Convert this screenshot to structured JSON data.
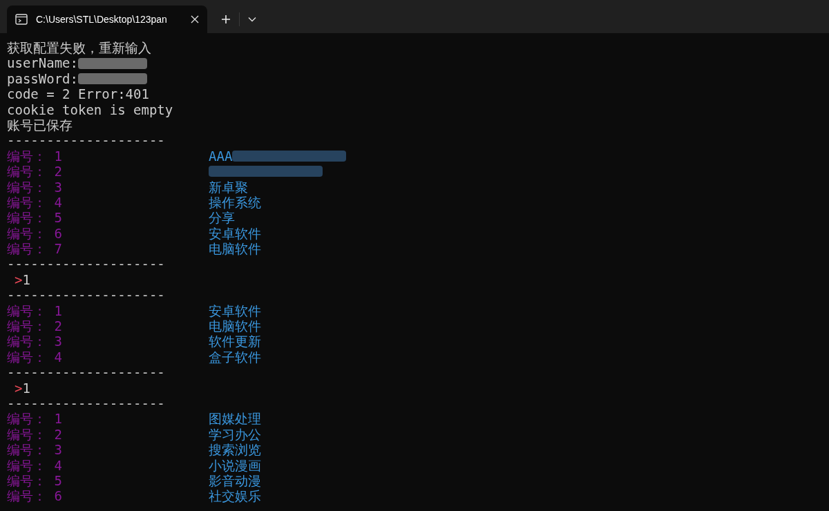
{
  "tab": {
    "title": "C:\\Users\\STL\\Desktop\\123pan"
  },
  "lines": [
    {
      "kind": "text",
      "text": "获取配置失败，重新输入"
    },
    {
      "kind": "field",
      "label": "userName:",
      "redacted": true
    },
    {
      "kind": "field",
      "label": "passWord:",
      "redacted": true
    },
    {
      "kind": "text",
      "text": "code = 2 Error:401"
    },
    {
      "kind": "text",
      "text": "cookie token is empty"
    },
    {
      "kind": "text",
      "text": "账号已保存"
    },
    {
      "kind": "separator",
      "text": "--------------------"
    },
    {
      "kind": "entry",
      "label": "编号： 1",
      "name": "AAA",
      "redacted": true
    },
    {
      "kind": "entry",
      "label": "编号： 2",
      "redacted": true
    },
    {
      "kind": "entry",
      "label": "编号： 3",
      "name": "新卓聚",
      "redacted": false
    },
    {
      "kind": "entry",
      "label": "编号： 4",
      "name": "操作系统",
      "redacted": false
    },
    {
      "kind": "entry",
      "label": "编号： 5",
      "name": "分享",
      "redacted": false
    },
    {
      "kind": "entry",
      "label": "编号： 6",
      "name": "安卓软件",
      "redacted": false
    },
    {
      "kind": "entry",
      "label": "编号： 7",
      "name": "电脑软件",
      "redacted": false
    },
    {
      "kind": "separator",
      "text": "--------------------"
    },
    {
      "kind": "prompt",
      "symbol": ">",
      "input": "1"
    },
    {
      "kind": "separator",
      "text": "--------------------"
    },
    {
      "kind": "entry",
      "label": "编号： 1",
      "name": "安卓软件",
      "redacted": false
    },
    {
      "kind": "entry",
      "label": "编号： 2",
      "name": "电脑软件",
      "redacted": false
    },
    {
      "kind": "entry",
      "label": "编号： 3",
      "name": "软件更新",
      "redacted": false
    },
    {
      "kind": "entry",
      "label": "编号： 4",
      "name": "盒子软件",
      "redacted": false
    },
    {
      "kind": "separator",
      "text": "--------------------"
    },
    {
      "kind": "prompt",
      "symbol": ">",
      "input": "1"
    },
    {
      "kind": "separator",
      "text": "--------------------"
    },
    {
      "kind": "entry",
      "label": "编号： 1",
      "name": "图媒处理",
      "redacted": false
    },
    {
      "kind": "entry",
      "label": "编号： 2",
      "name": "学习办公",
      "redacted": false
    },
    {
      "kind": "entry",
      "label": "编号： 3",
      "name": "搜索浏览",
      "redacted": false
    },
    {
      "kind": "entry",
      "label": "编号： 4",
      "name": "小说漫画",
      "redacted": false
    },
    {
      "kind": "entry",
      "label": "编号： 5",
      "name": "影音动漫",
      "redacted": false
    },
    {
      "kind": "entry",
      "label": "编号： 6",
      "name": "社交娱乐",
      "redacted": false
    }
  ]
}
